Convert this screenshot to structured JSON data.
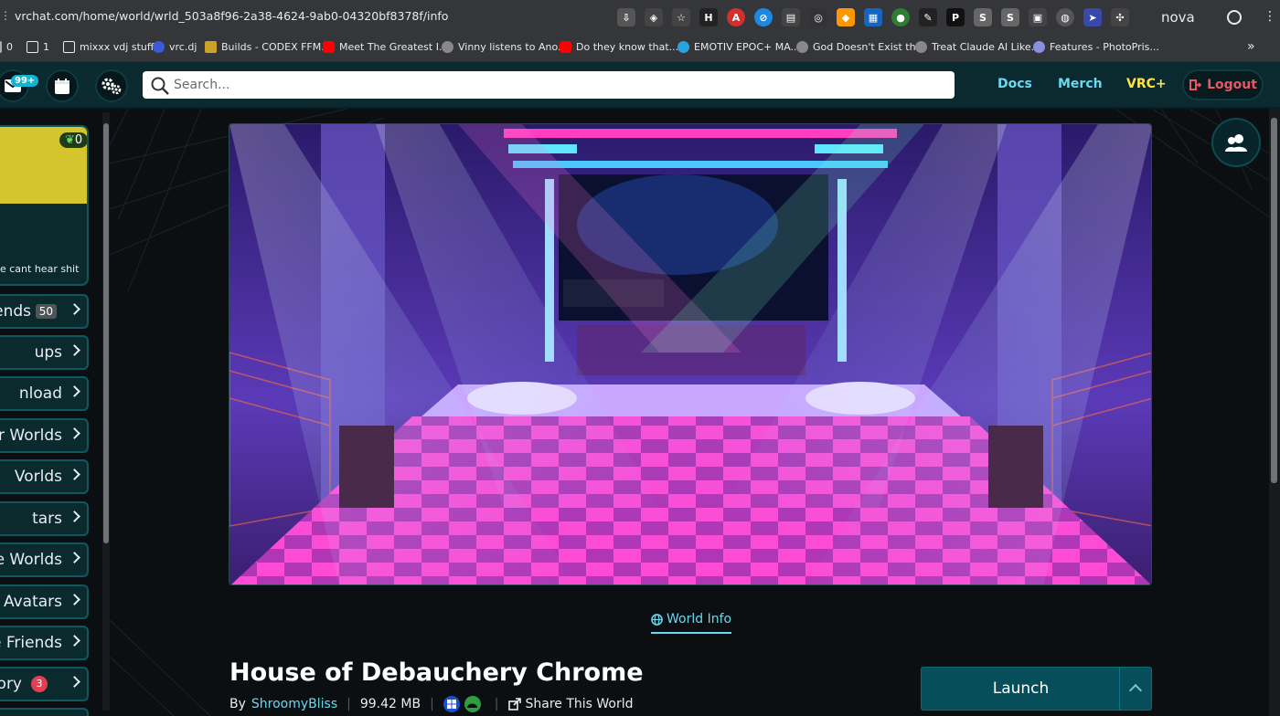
{
  "browser": {
    "url": "vrchat.com/home/world/wrld_503a8f96-2a38-4624-9ab0-04320bf8378f/info",
    "profile_name": "nova",
    "bookmarks": [
      {
        "label": "0"
      },
      {
        "label": "1"
      },
      {
        "label": "mixxx vdj stuff"
      },
      {
        "label": "vrc.dj"
      },
      {
        "label": "Builds - CODEX FFM..."
      },
      {
        "label": "Meet The Greatest I..."
      },
      {
        "label": "Vinny listens to Ano..."
      },
      {
        "label": "Do they know that..."
      },
      {
        "label": "EMOTIV EPOC+ MA..."
      },
      {
        "label": "God Doesn't Exist th..."
      },
      {
        "label": "Treat Claude AI Like..."
      },
      {
        "label": "Features - PhotoPris..."
      }
    ]
  },
  "topnav": {
    "notifications_badge": "99+",
    "search_placeholder": "Search...",
    "links": {
      "docs": "Docs",
      "merch": "Merch",
      "vrcplus": "VRC+"
    },
    "logout": "Logout"
  },
  "sidebar": {
    "profile": {
      "points": "0",
      "status": "e cant hear shit",
      "banner_color": "#d4c52e"
    },
    "items": [
      {
        "label": "ends",
        "count": "50"
      },
      {
        "label": "ups"
      },
      {
        "label": "nload"
      },
      {
        "label": "r Worlds"
      },
      {
        "label": "Vorlds"
      },
      {
        "label": "tars"
      },
      {
        "label": "e Worlds"
      },
      {
        "label": "Avatars"
      },
      {
        "label": "e Friends"
      },
      {
        "label": "ory",
        "count": "3"
      }
    ]
  },
  "world": {
    "tab": "World Info",
    "title": "House of Debauchery Chrome",
    "by_label": "By",
    "author": "ShroomyBliss",
    "size": "99.42 MB",
    "platforms": [
      "windows-icon",
      "android-icon"
    ],
    "share": "Share This World",
    "launch": "Launch"
  },
  "colors": {
    "accent": "#6ad9f0",
    "vrcplus": "#ffe445",
    "logout": "#ef5561",
    "launch_bg": "#064f5a",
    "nav_bg": "#0a2a30"
  }
}
